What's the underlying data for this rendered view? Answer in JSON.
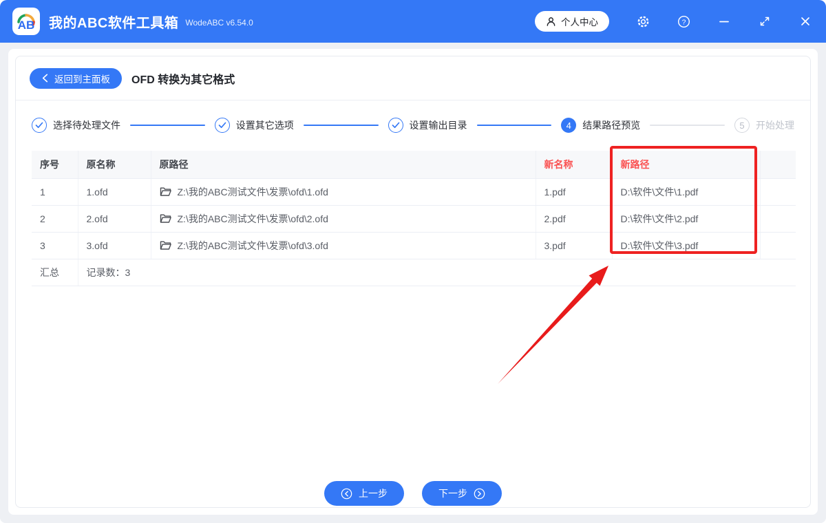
{
  "titlebar": {
    "app_title": "我的ABC软件工具箱",
    "version": "WodeABC v6.54.0",
    "logo_text": "AB",
    "profile_label": "个人中心"
  },
  "page": {
    "back_label": "返回到主面板",
    "title": "OFD 转换为其它格式"
  },
  "steps": [
    {
      "label": "选择待处理文件",
      "status": "done"
    },
    {
      "label": "设置其它选项",
      "status": "done"
    },
    {
      "label": "设置输出目录",
      "status": "done"
    },
    {
      "label": "结果路径预览",
      "status": "active",
      "number": "4"
    },
    {
      "label": "开始处理",
      "status": "pending",
      "number": "5"
    }
  ],
  "table": {
    "headers": [
      "序号",
      "原名称",
      "原路径",
      "新名称",
      "新路径"
    ],
    "rows": [
      {
        "index": "1",
        "old_name": "1.ofd",
        "old_path": "Z:\\我的ABC测试文件\\发票\\ofd\\1.ofd",
        "new_name": "1.pdf",
        "new_path": "D:\\软件\\文件\\1.pdf"
      },
      {
        "index": "2",
        "old_name": "2.ofd",
        "old_path": "Z:\\我的ABC测试文件\\发票\\ofd\\2.ofd",
        "new_name": "2.pdf",
        "new_path": "D:\\软件\\文件\\2.pdf"
      },
      {
        "index": "3",
        "old_name": "3.ofd",
        "old_path": "Z:\\我的ABC测试文件\\发票\\ofd\\3.ofd",
        "new_name": "3.pdf",
        "new_path": "D:\\软件\\文件\\3.pdf"
      }
    ],
    "summary_label": "汇总",
    "summary_value": "记录数：3"
  },
  "footer": {
    "prev_label": "上一步",
    "next_label": "下一步"
  },
  "colors": {
    "accent_blue": "#3478f6",
    "header_red_text": "#fa5151",
    "annotation_red": "#ee2222",
    "page_background": "#eef0f4"
  }
}
